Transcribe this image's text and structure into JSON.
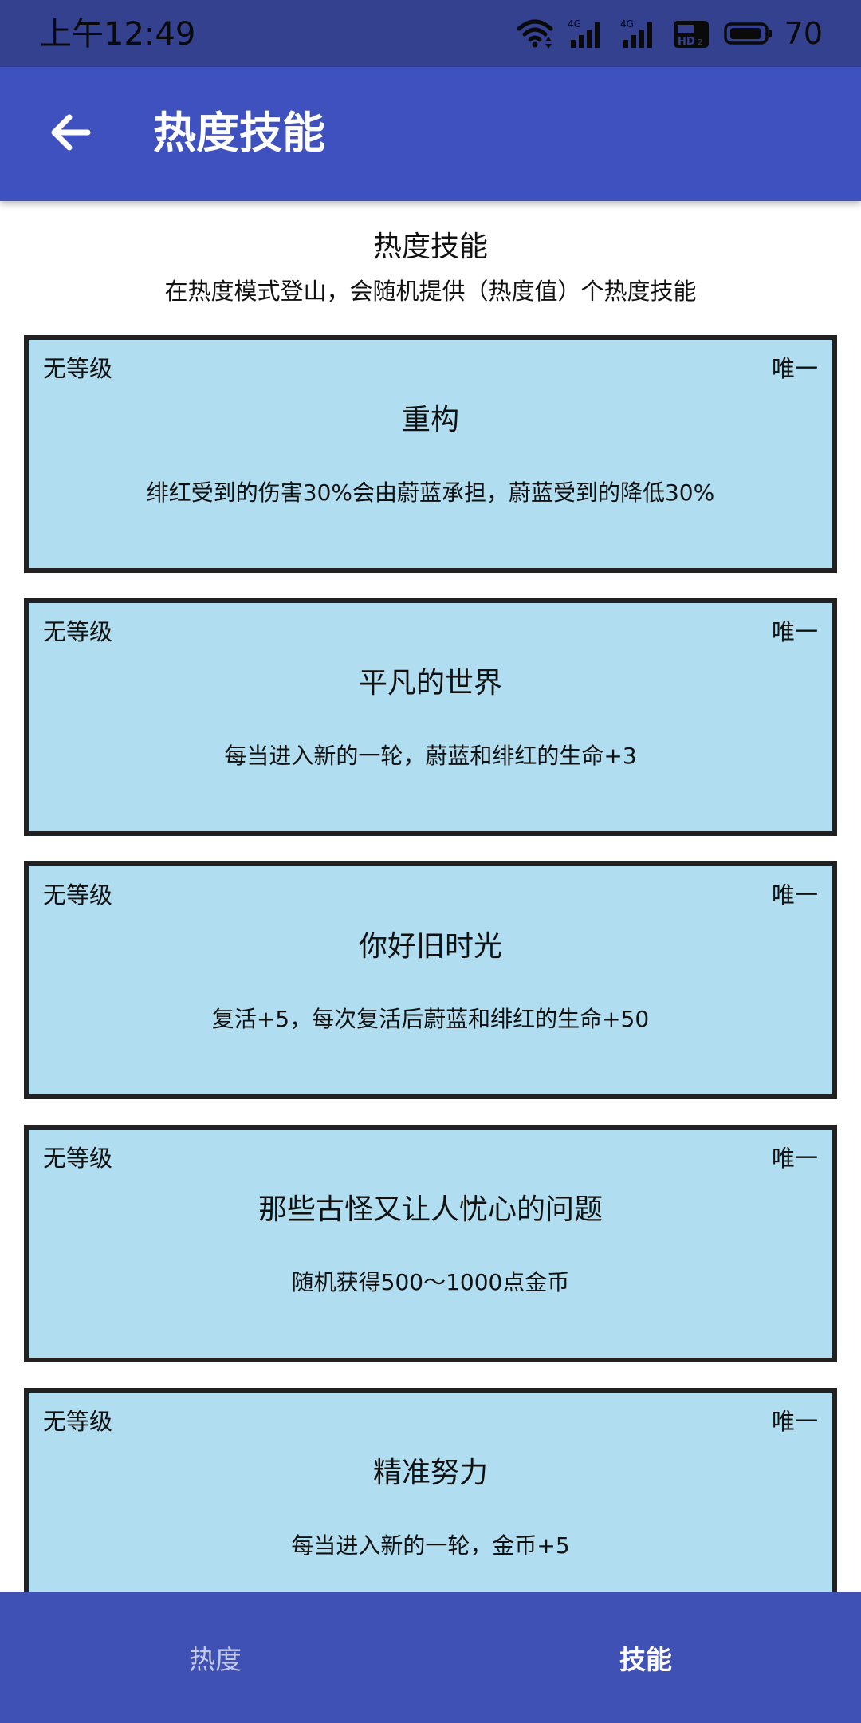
{
  "status_bar": {
    "time": "上午12:49",
    "battery": "70",
    "icons": [
      "wifi-icon",
      "signal-4g-icon",
      "signal-4g-icon",
      "hd-icon",
      "battery-icon"
    ]
  },
  "app_bar": {
    "back_icon": "arrow-left-icon",
    "title": "热度技能"
  },
  "section": {
    "heading": "热度技能",
    "subtitle": "在热度模式登山，会随机提供（热度值）个热度技能"
  },
  "cards": [
    {
      "level": "无等级",
      "tag": "唯一",
      "name": "重构",
      "description": "绯红受到的伤害30%会由蔚蓝承担，蔚蓝受到的降低30%"
    },
    {
      "level": "无等级",
      "tag": "唯一",
      "name": "平凡的世界",
      "description": "每当进入新的一轮，蔚蓝和绯红的生命+3"
    },
    {
      "level": "无等级",
      "tag": "唯一",
      "name": "你好旧时光",
      "description": "复活+5，每次复活后蔚蓝和绯红的生命+50"
    },
    {
      "level": "无等级",
      "tag": "唯一",
      "name": "那些古怪又让人忧心的问题",
      "description": "随机获得500～1000点金币"
    },
    {
      "level": "无等级",
      "tag": "唯一",
      "name": "精准努力",
      "description": "每当进入新的一轮，金币+5"
    }
  ],
  "bottom_nav": {
    "tabs": [
      {
        "label": "热度",
        "active": false
      },
      {
        "label": "技能",
        "active": true
      }
    ]
  },
  "colors": {
    "status_bar": "#33418f",
    "app_bar": "#3f51bf",
    "card_background": "#b0ddf0",
    "card_border": "#212121",
    "bottom_nav": "#3f51b5"
  }
}
